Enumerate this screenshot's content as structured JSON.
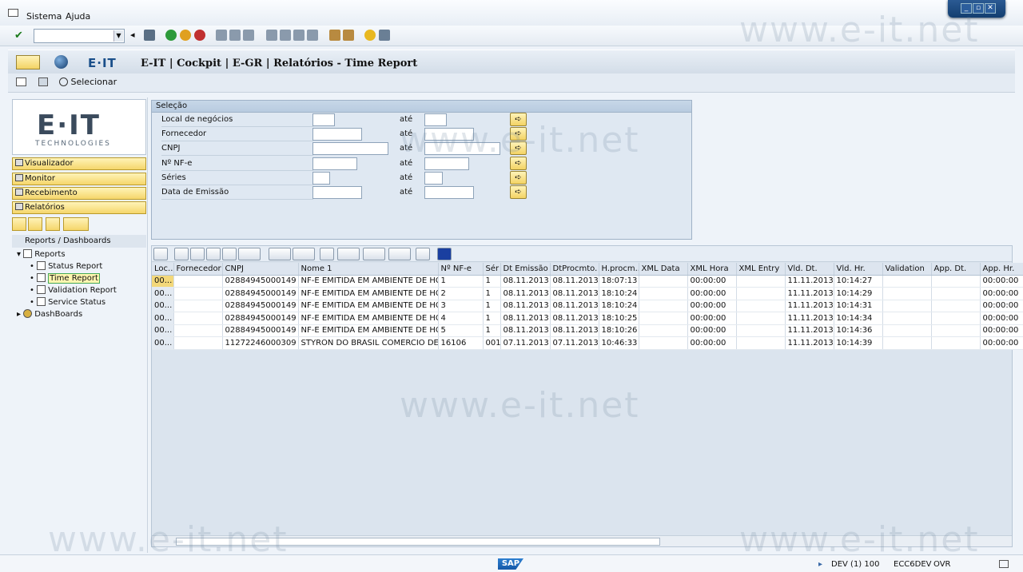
{
  "menu": {
    "sistema": "Sistema",
    "ajuda": "Ajuda"
  },
  "window_title": "E-IT | Cockpit | E-GR | Relatórios - Time Report",
  "logo": {
    "small": "E·IT",
    "big": "E·IT",
    "sub": "TECHNOLOGIES"
  },
  "app_toolbar": {
    "select": "Selecionar"
  },
  "nav": {
    "visualizador": "Visualizador",
    "monitor": "Monitor",
    "recebimento": "Recebimento",
    "relatorios": "Relatórios"
  },
  "tree": {
    "header": "Reports / Dashboards",
    "reports": "Reports",
    "items": [
      "Status Report",
      "Time Report",
      "Validation Report",
      "Service Status"
    ],
    "dashboards": "DashBoards"
  },
  "selection": {
    "title": "Seleção",
    "to": "até",
    "fields": [
      "Local de negócios",
      "Fornecedor",
      "CNPJ",
      "Nº NF-e",
      "Séries",
      "Data de Emissão"
    ]
  },
  "table": {
    "headers": [
      "Loc...",
      "Fornecedor",
      "CNPJ",
      "Nome 1",
      "Nº NF-e",
      "Sér",
      "Dt Emissão",
      "DtProcmto.",
      "H.procm...",
      "XML Data",
      "XML Hora",
      "XML Entry",
      "Vld. Dt.",
      "Vld. Hr.",
      "Validation",
      "App. Dt.",
      "App. Hr."
    ],
    "rows": [
      [
        "00...",
        "",
        "02884945000149",
        "NF-E EMITIDA EM AMBIENTE DE HO",
        "1",
        "1",
        "08.11.2013",
        "08.11.2013",
        "18:07:13",
        "",
        "00:00:00",
        "",
        "11.11.2013",
        "10:14:27",
        "",
        "",
        "00:00:00"
      ],
      [
        "00...",
        "",
        "02884945000149",
        "NF-E EMITIDA EM AMBIENTE DE HO",
        "2",
        "1",
        "08.11.2013",
        "08.11.2013",
        "18:10:24",
        "",
        "00:00:00",
        "",
        "11.11.2013",
        "10:14:29",
        "",
        "",
        "00:00:00"
      ],
      [
        "00...",
        "",
        "02884945000149",
        "NF-E EMITIDA EM AMBIENTE DE HO",
        "3",
        "1",
        "08.11.2013",
        "08.11.2013",
        "18:10:24",
        "",
        "00:00:00",
        "",
        "11.11.2013",
        "10:14:31",
        "",
        "",
        "00:00:00"
      ],
      [
        "00...",
        "",
        "02884945000149",
        "NF-E EMITIDA EM AMBIENTE DE HO",
        "4",
        "1",
        "08.11.2013",
        "08.11.2013",
        "18:10:25",
        "",
        "00:00:00",
        "",
        "11.11.2013",
        "10:14:34",
        "",
        "",
        "00:00:00"
      ],
      [
        "00...",
        "",
        "02884945000149",
        "NF-E EMITIDA EM AMBIENTE DE HO",
        "5",
        "1",
        "08.11.2013",
        "08.11.2013",
        "18:10:26",
        "",
        "00:00:00",
        "",
        "11.11.2013",
        "10:14:36",
        "",
        "",
        "00:00:00"
      ],
      [
        "00...",
        "",
        "11272246000309",
        "STYRON DO BRASIL COMERCIO DE P",
        "16106",
        "001",
        "07.11.2013",
        "07.11.2013",
        "10:46:33",
        "",
        "00:00:00",
        "",
        "11.11.2013",
        "10:14:39",
        "",
        "",
        "00:00:00"
      ]
    ]
  },
  "status": {
    "sap": "SAP",
    "system": "DEV (1) 100",
    "server": "ECC6DEV",
    "mode": "OVR"
  },
  "watermark": "www.e-it.net"
}
